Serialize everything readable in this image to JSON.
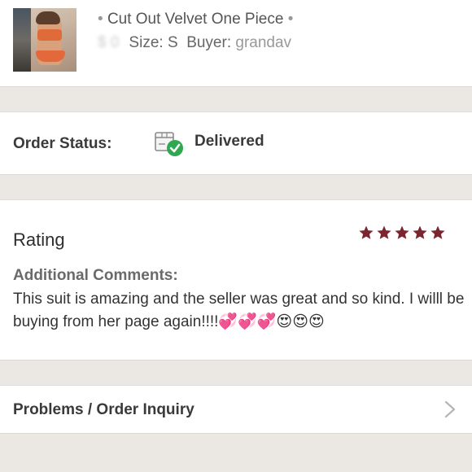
{
  "item": {
    "bullet": "•",
    "title": "Cut Out Velvet One Piece",
    "size_label": "Size: S",
    "buyer_label": "Buyer:",
    "buyer_name": "grandav"
  },
  "order_status": {
    "label": "Order Status:",
    "value": "Delivered",
    "icon": "delivered-box-icon"
  },
  "rating": {
    "title": "Rating",
    "stars": 5,
    "star_color": "#7b2530",
    "comments_heading": "Additional Comments:",
    "comments_text": "This suit is amazing and the seller was great and so kind. I willl be buying from her page again!!!!💞💞💞😍😍😍"
  },
  "problems": {
    "label": "Problems / Order Inquiry",
    "icon": "chevron-right-icon"
  },
  "colors": {
    "background": "#ebe8e3",
    "card": "#ffffff",
    "success": "#2fa84f"
  }
}
